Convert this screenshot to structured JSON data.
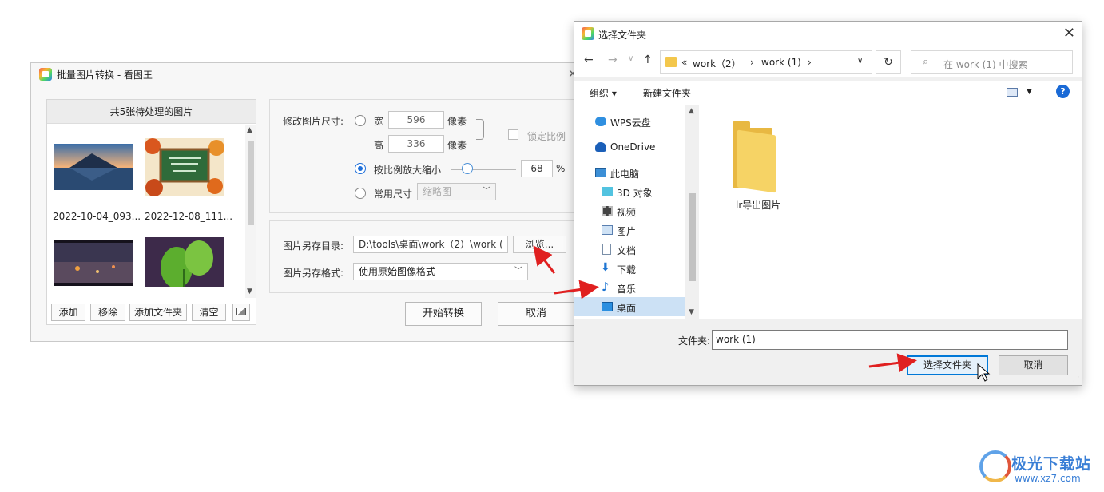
{
  "app": {
    "title": "批量图片转换 - 看图王",
    "left_panel": {
      "header": "共5张待处理的图片",
      "thumbnails": [
        {
          "caption": "2022-10-04_093..."
        },
        {
          "caption": "2022-12-08_111..."
        },
        {
          "caption": ""
        },
        {
          "caption": ""
        }
      ],
      "buttons": [
        "添加",
        "移除",
        "添加文件夹",
        "清空"
      ]
    },
    "resize": {
      "label": "修改图片尺寸:",
      "width_label": "宽",
      "width_value": "596",
      "height_label": "高",
      "height_value": "336",
      "unit": "像素",
      "lock_label": "锁定比例",
      "scale_label": "按比例放大缩小",
      "scale_value": "68",
      "scale_unit": "%",
      "preset_label": "常用尺寸",
      "preset_value": "缩略图"
    },
    "output": {
      "dir_label": "图片另存目录:",
      "dir_value": "D:\\tools\\桌面\\work（2）\\work (",
      "browse_label": "浏览...",
      "format_label": "图片另存格式:",
      "format_value": "使用原始图像格式"
    },
    "actions": {
      "start": "开始转换",
      "cancel": "取消"
    }
  },
  "dialog": {
    "title": "选择文件夹",
    "address": {
      "prefix": "«",
      "crumb1": "work（2）",
      "sep": "›",
      "crumb2": "work (1)"
    },
    "search_placeholder": "在 work (1) 中搜索",
    "toolbar": {
      "organize": "组织 ▾",
      "new_folder": "新建文件夹",
      "help": "?"
    },
    "nav_items": [
      {
        "label": "WPS云盘",
        "icon": "cloud-icon"
      },
      {
        "label": "OneDrive",
        "icon": "onedrive-icon"
      },
      {
        "label": "此电脑",
        "icon": "computer-icon"
      },
      {
        "label": "3D 对象",
        "icon": "cube-icon"
      },
      {
        "label": "视频",
        "icon": "video-icon"
      },
      {
        "label": "图片",
        "icon": "picture-icon"
      },
      {
        "label": "文档",
        "icon": "document-icon"
      },
      {
        "label": "下载",
        "icon": "download-icon"
      },
      {
        "label": "音乐",
        "icon": "music-icon"
      },
      {
        "label": "桌面",
        "icon": "desktop-icon"
      }
    ],
    "folders": [
      {
        "name": "lr导出图片"
      }
    ],
    "folder_field_label": "文件夹:",
    "folder_field_value": "work (1)",
    "select_button": "选择文件夹",
    "cancel_button": "取消"
  },
  "watermark": {
    "line1": "极光下载站",
    "line2": "www.xz7.com"
  }
}
